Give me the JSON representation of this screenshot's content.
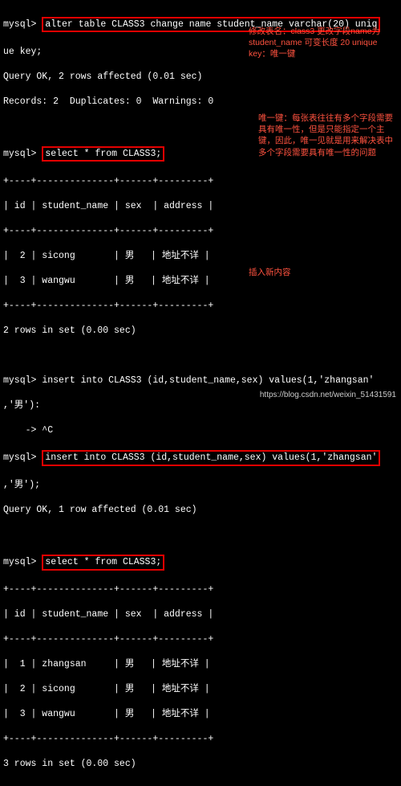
{
  "prompt": "mysql>",
  "cmd_alter": "alter table CLASS3 change name student_name varchar(20) uniq",
  "cmd_alter2": "ue key;",
  "alter_result1": "Query OK, 2 rows affected (0.01 sec)",
  "alter_result2": "Records: 2  Duplicates: 0  Warnings: 0",
  "cmd_select1": "select * from CLASS3;",
  "table": {
    "sep": "+----+--------------+------+---------+",
    "head": "| id | student_name | sex  | address |",
    "rows": [
      "|  2 | sicong       | 男   | 地址不详 |",
      "|  3 | wangwu       | 男   | 地址不详 |"
    ],
    "footer": "2 rows in set (0.00 sec)"
  },
  "cmd_insert1a": "insert into CLASS3 (id,student_name,sex) values(1,'zhangsan'",
  "cmd_insert1b": ",'男'):",
  "cmd_cancel": "    -> ^C",
  "cmd_insert2a": "insert into CLASS3 (id,student_name,sex) values(1,'zhangsan'",
  "cmd_insert2b": ",'男');",
  "insert_result": "Query OK, 1 row affected (0.01 sec)",
  "cmd_select2": "select * from CLASS3;",
  "table2": {
    "sep": "+----+--------------+------+---------+",
    "head": "| id | student_name | sex  | address |",
    "rows": [
      "|  1 | zhangsan     | 男   | 地址不详 |",
      "|  2 | sicong       | 男   | 地址不详 |",
      "|  3 | wangwu       | 男   | 地址不详 |"
    ],
    "footer": "3 rows in set (0.00 sec)"
  },
  "anno1": "修改表名：class3 更改字段name为student_name 可变长度 20 unique key：唯一键",
  "anno2": "唯一键：每张表往往有多个字段需要具有唯一性，但是只能指定一个主键，因此，唯一见就是用来解决表中多个字段需要具有唯一性的问题",
  "anno3": "插入新内容",
  "watermark": "https://blog.csdn.net/weixin_51431591"
}
